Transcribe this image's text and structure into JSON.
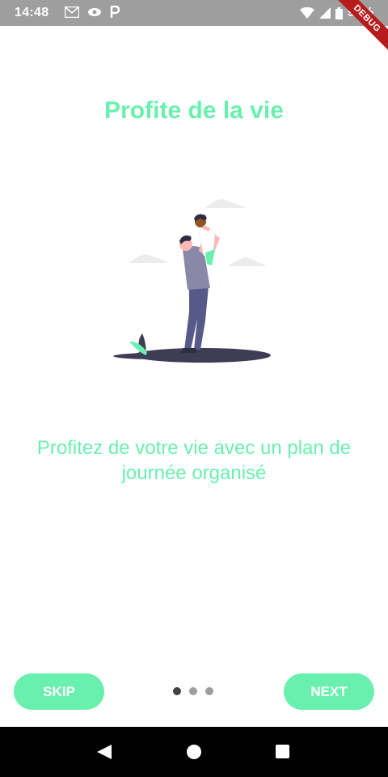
{
  "status_bar": {
    "time": "14:48",
    "battery": "99%",
    "debug": "DEBUG"
  },
  "page": {
    "title": "Profite de la vie",
    "description": "Profitez de votre vie avec un plan de journée organisé"
  },
  "footer": {
    "skip_label": "SKIP",
    "next_label": "NEXT",
    "dots_count": 3,
    "active_dot": 0
  },
  "colors": {
    "accent": "#69f0ae",
    "dark": "#3f3d56",
    "shirt": "#8a88a8",
    "pants": "#575a89",
    "cloud": "#ececec",
    "skin": "#ffb8b8"
  }
}
